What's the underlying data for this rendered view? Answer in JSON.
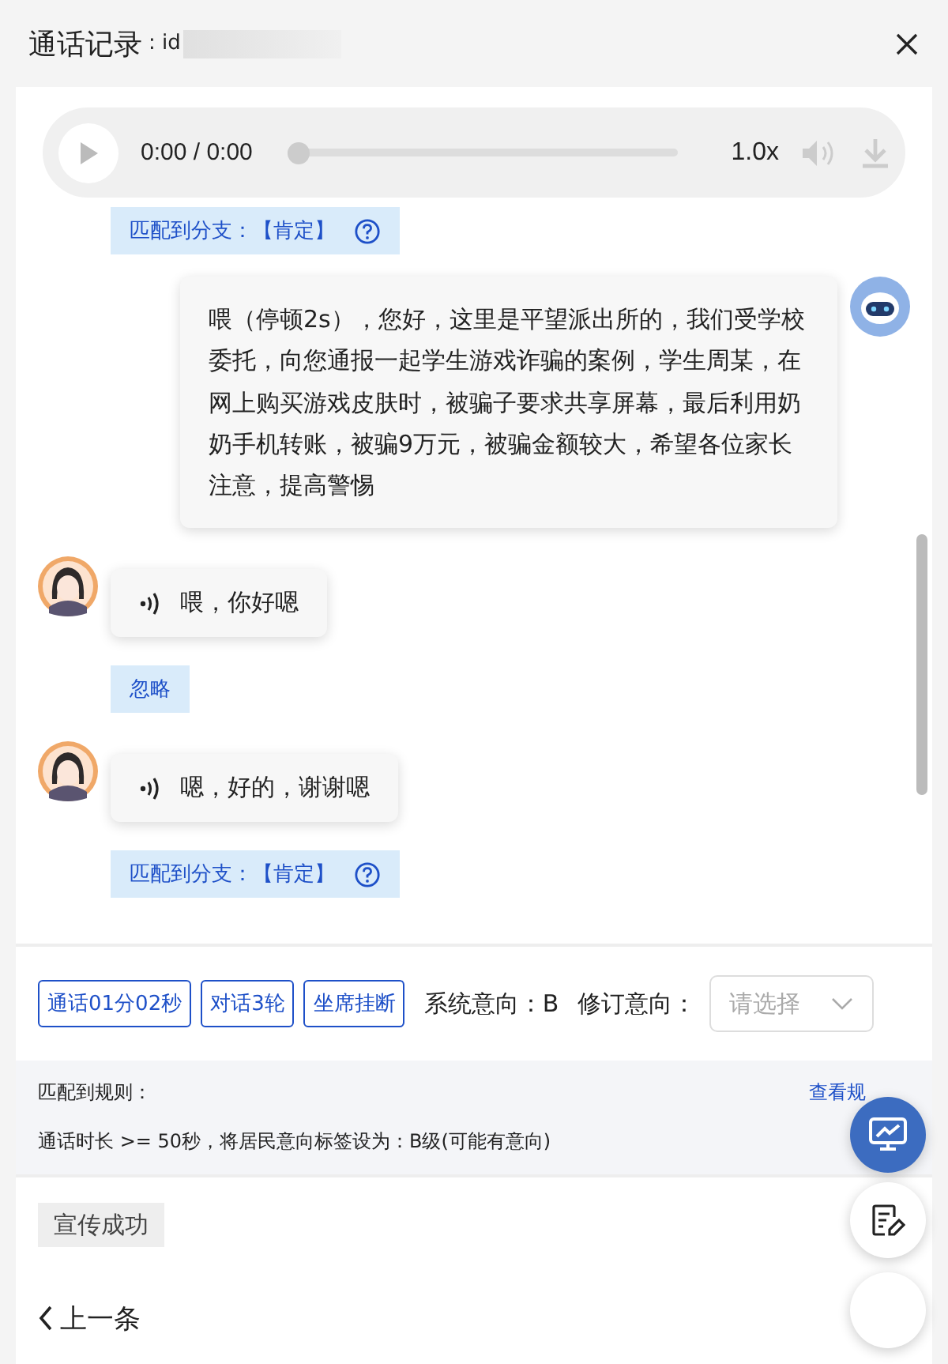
{
  "window": {
    "title": "通话记录",
    "id_label": ": id"
  },
  "player": {
    "time": "0:00 / 0:00",
    "level": 0,
    "speed": "1.0x"
  },
  "messages": [
    {
      "kind": "tag",
      "text": "匹配到分支：【肯定】",
      "help": true
    },
    {
      "kind": "bot",
      "text": "喂（停顿2s），您好，这里是平望派出所的，我们受学校委托，向您通报一起学生游戏诈骗的案例，学生周某，在网上购买游戏皮肤时，被骗子要求共享屏幕，最后利用奶奶手机转账，被骗9万元，被骗金额较大，希望各位家长注意，提高警惕"
    },
    {
      "kind": "user",
      "text": "喂，你好嗯"
    },
    {
      "kind": "tag",
      "text": "忽略",
      "help": false
    },
    {
      "kind": "user",
      "text": "嗯，好的，谢谢嗯"
    },
    {
      "kind": "tag",
      "text": "匹配到分支：【肯定】",
      "help": true
    }
  ],
  "stats": {
    "tags": [
      "通话01分02秒",
      "对话3轮",
      "坐席挂断"
    ],
    "system_label": "系统意向：",
    "system_value": "B",
    "revised_label": "修订意向：",
    "select_placeholder": "请选择"
  },
  "rule": {
    "title": "匹配到规则：",
    "link": "查看规",
    "text": "通话时长 >= 50秒，将居民意向标签设为：B级(可能有意向)"
  },
  "result_tag": "宣传成功",
  "footer": {
    "prev": "上一条"
  }
}
